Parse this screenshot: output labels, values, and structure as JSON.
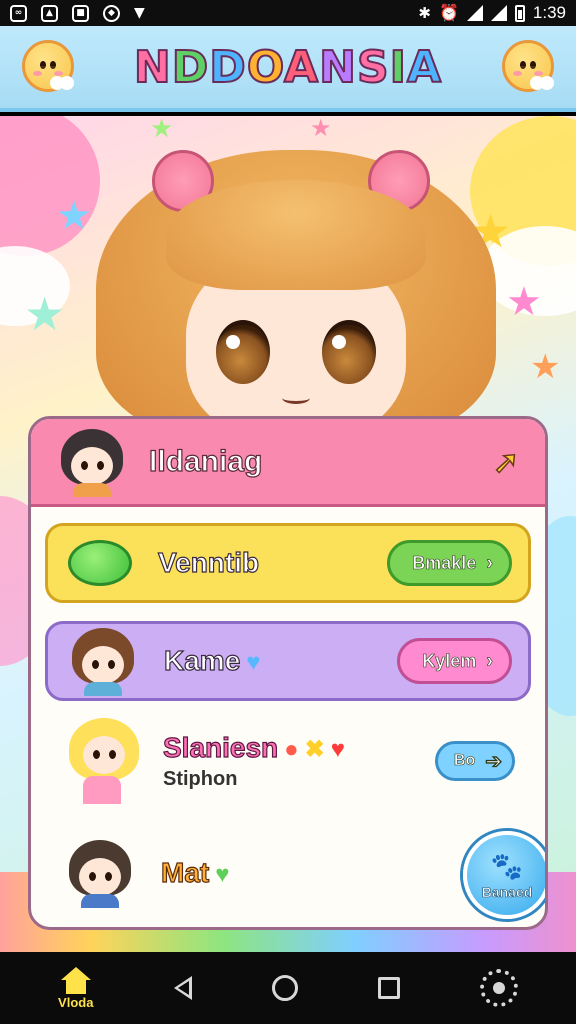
{
  "status_bar": {
    "time": "1:39",
    "icons": [
      "notification-icon",
      "image-icon",
      "app-icon",
      "shield-icon",
      "dropdown-icon",
      "bluetooth-icon",
      "alarm-icon",
      "wifi-icon",
      "signal-icon",
      "battery-icon"
    ]
  },
  "header": {
    "title_letters": [
      "N",
      "D",
      "D",
      "O",
      "A",
      "N",
      "S",
      "I",
      "A"
    ]
  },
  "card": {
    "title": "Ildaniag",
    "rows": [
      {
        "name": "Venntib",
        "button": "Bmakle"
      },
      {
        "name": "Kame",
        "button": "Kylem"
      },
      {
        "name": "Slaniesn",
        "subtitle": "Stiphon",
        "button": "Bo"
      },
      {
        "name": "Mat"
      }
    ],
    "fab_label": "Banaed"
  },
  "nav": {
    "home_label": "Vloda"
  },
  "colors": {
    "header_bg": "#a7dcf5",
    "card_head": "#f989ae",
    "yellow_row": "#fbe05a",
    "purple_row": "#cbaef3",
    "green_button": "#7bd455",
    "pink_button": "#ff8ad0",
    "blue_button": "#7fd1ff",
    "nav_accent": "#ffe14a"
  }
}
